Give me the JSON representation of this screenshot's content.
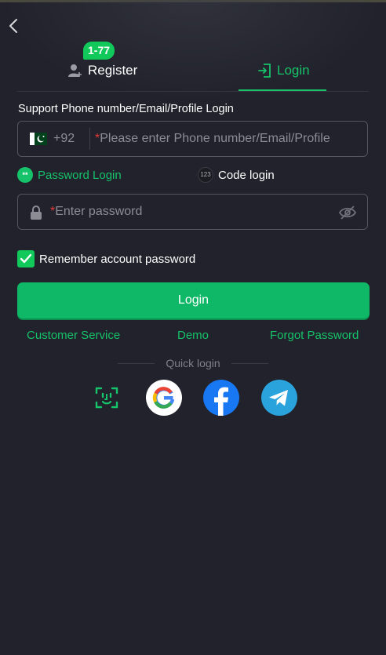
{
  "header": {
    "back_icon": "chevron-left-icon"
  },
  "tabs": {
    "register": {
      "label": "Register",
      "badge": "1-77",
      "icon": "user-add-icon"
    },
    "login": {
      "label": "Login",
      "icon": "login-door-icon",
      "active": true
    }
  },
  "form": {
    "support_label": "Support Phone number/Email/Profile Login",
    "phone": {
      "flag": "pakistan-flag",
      "country_code": "+92",
      "placeholder": "Please enter Phone number/Email/Profile",
      "required_marker": "*"
    },
    "modes": {
      "password_login": "Password Login",
      "password_icon_text": "**",
      "code_login": "Code login",
      "code_icon_text": "123"
    },
    "password": {
      "placeholder": "Enter password",
      "required_marker": "*",
      "lock_icon": "lock-icon",
      "toggle_icon": "eye-off-icon"
    },
    "remember": {
      "label": "Remember account password",
      "checked": true
    },
    "login_button": "Login"
  },
  "links": {
    "customer_service": "Customer Service",
    "demo": "Demo",
    "forgot_password": "Forgot Password"
  },
  "quick_login": {
    "label": "Quick login",
    "providers": [
      "face-id",
      "google",
      "facebook",
      "telegram"
    ]
  },
  "colors": {
    "background": "#21222b",
    "accent": "#16c26a",
    "button": "#0fb866",
    "badge": "#11c85a",
    "required": "#e23a3a",
    "facebook": "#1877f2",
    "telegram": "#2aa3dc"
  }
}
